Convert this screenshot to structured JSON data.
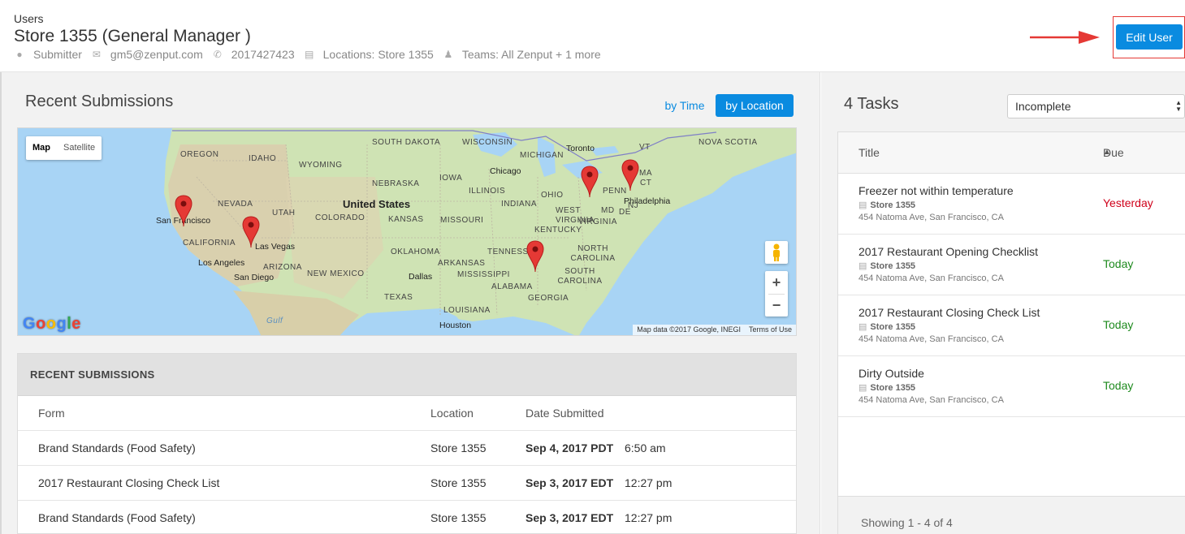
{
  "header": {
    "breadcrumb": "Users",
    "title": "Store 1355 (General Manager )",
    "role": "Submitter",
    "email": "gm5@zenput.com",
    "phone": "2017427423",
    "locations": "Locations: Store 1355",
    "teams": "Teams: All Zenput + 1 more",
    "edit_label": "Edit User"
  },
  "recent": {
    "heading": "Recent Submissions",
    "by_time": "by Time",
    "by_location": "by Location",
    "panel_title": "RECENT SUBMISSIONS",
    "columns": [
      "Form",
      "Location",
      "Date Submitted"
    ],
    "rows": [
      {
        "form": "Brand Standards (Food Safety)",
        "location": "Store 1355",
        "date": "Sep 4, 2017 PDT",
        "time": "6:50 am"
      },
      {
        "form": "2017 Restaurant Closing Check List",
        "location": "Store 1355",
        "date": "Sep 3, 2017 EDT",
        "time": "12:27 pm"
      },
      {
        "form": "Brand Standards (Food Safety)",
        "location": "Store 1355",
        "date": "Sep 3, 2017 EDT",
        "time": "12:27 pm"
      }
    ]
  },
  "map": {
    "type_map": "Map",
    "type_satellite": "Satellite",
    "zoom_in": "+",
    "zoom_out": "−",
    "logo": [
      "G",
      "o",
      "o",
      "g",
      "l",
      "e"
    ],
    "attribution": "Map data ©2017 Google, INEGI",
    "terms": "Terms of Use",
    "country": "United States",
    "states": [
      "OREGON",
      "IDAHO",
      "WYOMING",
      "SOUTH DAKOTA",
      "WISCONSIN",
      "MICHIGAN",
      "NEBRASKA",
      "IOWA",
      "ILLINOIS",
      "INDIANA",
      "OHIO",
      "PENN",
      "NEVADA",
      "UTAH",
      "COLORADO",
      "KANSAS",
      "MISSOURI",
      "KENTUCKY",
      "CALIFORNIA",
      "ARIZONA",
      "NEW MEXICO",
      "OKLAHOMA",
      "ARKANSAS",
      "TENNESSEE",
      "MISSISSIPPI",
      "ALABAMA",
      "GEORGIA",
      "TEXAS",
      "LOUISIANA",
      "NORTH CAROLINA",
      "SOUTH CAROLINA",
      "VIRGINIA",
      "WEST VIRGINIA",
      "NOVA SCOTIA",
      "VT",
      "MD",
      "DE",
      "NJ",
      "MA",
      "CT"
    ],
    "cities": [
      "San Francisco",
      "Las Vegas",
      "Los Angeles",
      "San Diego",
      "Chicago",
      "Toronto",
      "Philadelphia",
      "Dallas",
      "Houston"
    ],
    "gulf": "Gulf"
  },
  "tasks": {
    "title": "4 Tasks",
    "filter": "Incomplete",
    "col_title": "Title",
    "col_due": "Due",
    "items": [
      {
        "name": "Freezer not within temperature",
        "store": "Store 1355",
        "address": "454 Natoma Ave, San Francisco, CA",
        "due": "Yesterday"
      },
      {
        "name": "2017 Restaurant Opening Checklist",
        "store": "Store 1355",
        "address": "454 Natoma Ave, San Francisco, CA",
        "due": "Today"
      },
      {
        "name": "2017 Restaurant Closing Check List",
        "store": "Store 1355",
        "address": "454 Natoma Ave, San Francisco, CA",
        "due": "Today"
      },
      {
        "name": "Dirty Outside",
        "store": "Store 1355",
        "address": "454 Natoma Ave, San Francisco, CA",
        "due": "Today"
      }
    ],
    "footer": "Showing 1 - 4 of 4"
  },
  "colors": {
    "accent": "#0a8be0",
    "overdue": "#d0021b",
    "ok": "#1e8a1e",
    "pin": "#e53935"
  }
}
